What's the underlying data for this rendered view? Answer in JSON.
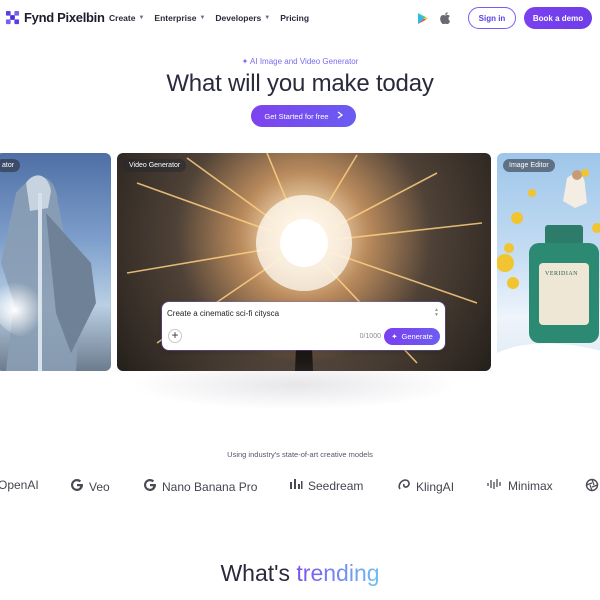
{
  "brand": {
    "name": "Fynd Pixelbin",
    "logo_icon": "pixelbin-logo-icon",
    "accent": "#7c3aed"
  },
  "nav": {
    "links": [
      {
        "label": "Create",
        "dropdown": true
      },
      {
        "label": "Enterprise",
        "dropdown": true
      },
      {
        "label": "Developers",
        "dropdown": true
      },
      {
        "label": "Pricing",
        "dropdown": false
      }
    ],
    "sign_in": "Sign in",
    "book_demo": "Book a demo"
  },
  "hero": {
    "eyebrow": "AI Image and Video Generator",
    "title": "What will you make today",
    "cta": "Get Started for free"
  },
  "cards": {
    "left_tag": "ator",
    "center_tag": "Video Generator",
    "right_tag": "Image Editor",
    "product_label": "VERIDIAN"
  },
  "prompt": {
    "text": "Create a cinematic sci-fi citysca",
    "count": "0/1000",
    "generate": "Generate"
  },
  "models": {
    "caption": "Using industry's state-of-art creative models",
    "items": [
      "OpenAI",
      "Veo",
      "Nano Banana Pro",
      "Seedream",
      "KlingAI",
      "Minimax"
    ]
  },
  "trending": {
    "prefix": "What's ",
    "highlight": "trending"
  }
}
